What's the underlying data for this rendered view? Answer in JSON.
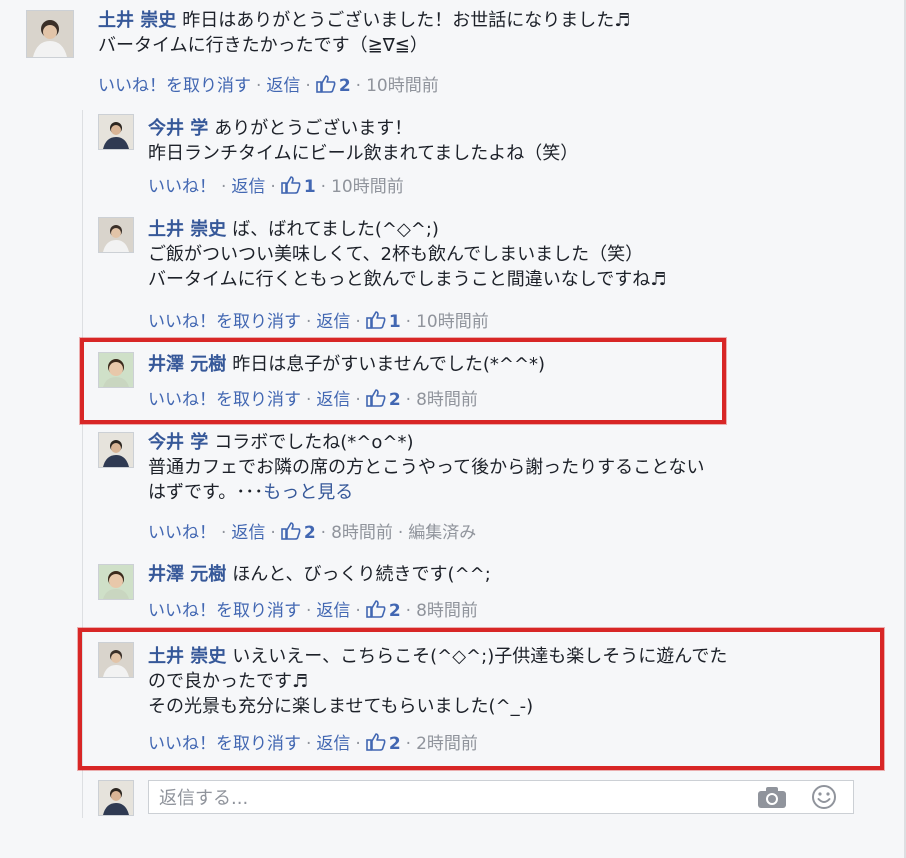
{
  "colors": {
    "accent": "#365899",
    "link": "#4267b2",
    "muted": "#90949c",
    "highlight": "#d82626"
  },
  "comments": [
    {
      "author": "土井 崇史",
      "lines": [
        "昨日はありがとうございました！お世話になりました♬",
        "バータイムに行きたかったです（≧∇≦）"
      ],
      "like_label": "いいね！を取り消す",
      "reply_label": "返信",
      "likes": "2",
      "time": "10時間前"
    },
    {
      "author": "今井 学",
      "lines": [
        "ありがとうございます！",
        "昨日ランチタイムにビール飲まれてましたよね（笑）"
      ],
      "like_label": "いいね！",
      "reply_label": "返信",
      "likes": "1",
      "time": "10時間前"
    },
    {
      "author": "土井 崇史",
      "lines": [
        "ば、ばれてました(^◇^;)",
        "ご飯がついつい美味しくて、2杯も飲んでしまいました（笑）",
        "バータイムに行くともっと飲んでしまうこと間違いなしですね♬"
      ],
      "like_label": "いいね！を取り消す",
      "reply_label": "返信",
      "likes": "1",
      "time": "10時間前"
    },
    {
      "author": "井澤 元樹",
      "lines": [
        "昨日は息子がすいませんでした(*^^*)"
      ],
      "like_label": "いいね！を取り消す",
      "reply_label": "返信",
      "likes": "2",
      "time": "8時間前"
    },
    {
      "author": "今井 学",
      "lines": [
        "コラボでしたね(*^o^*)",
        "普通カフェでお隣の席の方とこうやって後から謝ったりすることない",
        "はずです。･･･"
      ],
      "see_more": "もっと見る",
      "like_label": "いいね！",
      "reply_label": "返信",
      "likes": "2",
      "time": "8時間前",
      "edited": "編集済み"
    },
    {
      "author": "井澤 元樹",
      "lines": [
        "ほんと、びっくり続きです(^^;"
      ],
      "like_label": "いいね！を取り消す",
      "reply_label": "返信",
      "likes": "2",
      "time": "8時間前"
    },
    {
      "author": "土井 崇史",
      "lines": [
        "いえいえー、こちらこそ(^◇^;)子供達も楽しそうに遊んでた",
        "ので良かったです♬",
        "その光景も充分に楽しませてもらいました(^_-)"
      ],
      "like_label": "いいね！を取り消す",
      "reply_label": "返信",
      "likes": "2",
      "time": "2時間前"
    }
  ],
  "reply_box": {
    "placeholder": "返信する..."
  },
  "icons": {
    "camera": "camera-icon",
    "emoji": "smiley-icon",
    "like": "thumbs-up-icon"
  }
}
